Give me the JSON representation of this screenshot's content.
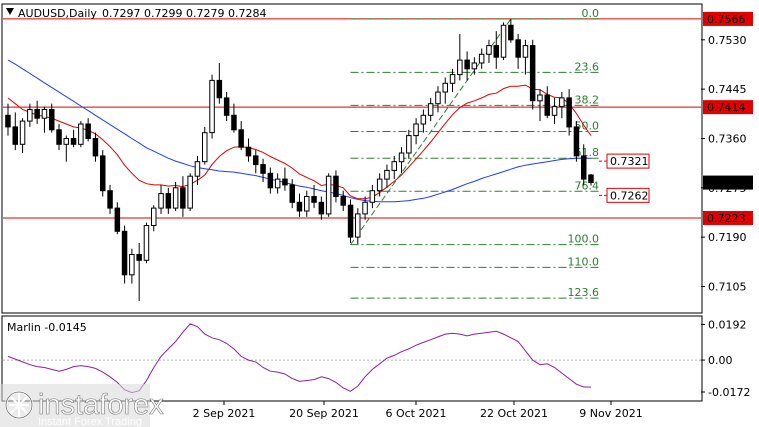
{
  "header": {
    "symbol_label": "AUDUSD,Daily",
    "ohlc_label": "0.7297 0.7299 0.7279 0.7284"
  },
  "oscillator": {
    "label": "Marlin -0.0145"
  },
  "watermark": {
    "brand": "instaforex",
    "tagline": "Instant Forex Trading"
  },
  "colors": {
    "red": "#e00000",
    "blue": "#1f3cff",
    "green": "#2e7d32",
    "purple": "#8b1fa6",
    "grid": "#b5b5b5",
    "bull": "#ffffff",
    "bear": "#000000"
  },
  "chart_data": [
    {
      "type": "candlestick",
      "title": "AUDUSD,Daily",
      "ylim": [
        0.7061,
        0.759
      ],
      "y_ticks": [
        "0.7530",
        "0.7445",
        "0.7360",
        "0.7275",
        "0.7190",
        "0.7105"
      ],
      "x_ticks": [
        "2 Sep 2021",
        "20 Sep 2021",
        "6 Oct 2021",
        "22 Oct 2021",
        "9 Nov 2021"
      ],
      "horizontal_levels": [
        {
          "value": 0.7566,
          "label": "0.7566",
          "color": "red"
        },
        {
          "value": 0.7414,
          "label": "0.7414",
          "color": "red"
        },
        {
          "value": 0.7223,
          "label": "0.7223",
          "color": "red"
        }
      ],
      "price_tags": [
        {
          "value": 0.7321,
          "label": "0.7321",
          "style": "outlined-red"
        },
        {
          "value": 0.7262,
          "label": "0.7262",
          "style": "outlined-red"
        },
        {
          "value": 0.7284,
          "label": "0.7284",
          "style": "current-black"
        }
      ],
      "fibonacci": {
        "high": 0.7566,
        "low": 0.7177,
        "levels": [
          {
            "label": "0.0",
            "value": 0.7566
          },
          {
            "label": "23.6",
            "value": 0.7474
          },
          {
            "label": "38.2",
            "value": 0.7417
          },
          {
            "label": "50.0",
            "value": 0.7372
          },
          {
            "label": "61.8",
            "value": 0.7326
          },
          {
            "label": "76.4",
            "value": 0.7269
          },
          {
            "label": "100.0",
            "value": 0.7177
          },
          {
            "label": "110.0",
            "value": 0.7138
          },
          {
            "label": "123.6",
            "value": 0.7085
          }
        ]
      },
      "candles": [
        [
          0.74,
          0.742,
          0.7365,
          0.738
        ],
        [
          0.738,
          0.7405,
          0.734,
          0.735
        ],
        [
          0.735,
          0.7395,
          0.7335,
          0.739
        ],
        [
          0.739,
          0.742,
          0.738,
          0.741
        ],
        [
          0.741,
          0.7425,
          0.7385,
          0.7395
        ],
        [
          0.7395,
          0.7415,
          0.737,
          0.741
        ],
        [
          0.741,
          0.742,
          0.737,
          0.7375
        ],
        [
          0.7375,
          0.7385,
          0.734,
          0.735
        ],
        [
          0.735,
          0.7365,
          0.732,
          0.736
        ],
        [
          0.736,
          0.7375,
          0.7345,
          0.735
        ],
        [
          0.735,
          0.739,
          0.7345,
          0.7385
        ],
        [
          0.7385,
          0.7395,
          0.7355,
          0.736
        ],
        [
          0.736,
          0.737,
          0.732,
          0.733
        ],
        [
          0.733,
          0.734,
          0.726,
          0.727
        ],
        [
          0.727,
          0.728,
          0.723,
          0.724
        ],
        [
          0.724,
          0.725,
          0.7195,
          0.72
        ],
        [
          0.72,
          0.721,
          0.711,
          0.7125
        ],
        [
          0.7125,
          0.717,
          0.711,
          0.716
        ],
        [
          0.716,
          0.718,
          0.708,
          0.715
        ],
        [
          0.715,
          0.7215,
          0.7145,
          0.721
        ],
        [
          0.721,
          0.7245,
          0.72,
          0.724
        ],
        [
          0.724,
          0.728,
          0.723,
          0.7265
        ],
        [
          0.7265,
          0.7275,
          0.723,
          0.724
        ],
        [
          0.724,
          0.7285,
          0.7235,
          0.7275
        ],
        [
          0.7275,
          0.7295,
          0.7225,
          0.724
        ],
        [
          0.724,
          0.73,
          0.7235,
          0.7295
        ],
        [
          0.7295,
          0.733,
          0.728,
          0.732
        ],
        [
          0.732,
          0.738,
          0.7315,
          0.737
        ],
        [
          0.737,
          0.747,
          0.736,
          0.746
        ],
        [
          0.746,
          0.749,
          0.742,
          0.743
        ],
        [
          0.743,
          0.744,
          0.739,
          0.74
        ],
        [
          0.74,
          0.742,
          0.737,
          0.7375
        ],
        [
          0.7375,
          0.739,
          0.734,
          0.7345
        ],
        [
          0.7345,
          0.736,
          0.732,
          0.733
        ],
        [
          0.733,
          0.734,
          0.73,
          0.7315
        ],
        [
          0.7315,
          0.7325,
          0.7285,
          0.73
        ],
        [
          0.73,
          0.731,
          0.7265,
          0.7275
        ],
        [
          0.7275,
          0.73,
          0.7265,
          0.729
        ],
        [
          0.729,
          0.731,
          0.727,
          0.728
        ],
        [
          0.728,
          0.729,
          0.724,
          0.725
        ],
        [
          0.725,
          0.7265,
          0.7225,
          0.7235
        ],
        [
          0.7235,
          0.727,
          0.7225,
          0.726
        ],
        [
          0.726,
          0.728,
          0.724,
          0.725
        ],
        [
          0.725,
          0.726,
          0.722,
          0.723
        ],
        [
          0.723,
          0.73,
          0.7225,
          0.7295
        ],
        [
          0.7295,
          0.7305,
          0.725,
          0.726
        ],
        [
          0.726,
          0.727,
          0.7235,
          0.7245
        ],
        [
          0.7245,
          0.7255,
          0.718,
          0.719
        ],
        [
          0.719,
          0.724,
          0.7178,
          0.723
        ],
        [
          0.723,
          0.726,
          0.722,
          0.725
        ],
        [
          0.725,
          0.728,
          0.724,
          0.727
        ],
        [
          0.727,
          0.73,
          0.726,
          0.729
        ],
        [
          0.729,
          0.7315,
          0.7275,
          0.7305
        ],
        [
          0.7305,
          0.733,
          0.729,
          0.732
        ],
        [
          0.732,
          0.7345,
          0.73,
          0.7335
        ],
        [
          0.7335,
          0.7375,
          0.7325,
          0.7365
        ],
        [
          0.7365,
          0.7395,
          0.735,
          0.7385
        ],
        [
          0.7385,
          0.741,
          0.737,
          0.74
        ],
        [
          0.74,
          0.743,
          0.739,
          0.742
        ],
        [
          0.742,
          0.745,
          0.7405,
          0.744
        ],
        [
          0.744,
          0.7465,
          0.742,
          0.7455
        ],
        [
          0.7455,
          0.748,
          0.744,
          0.747
        ],
        [
          0.747,
          0.754,
          0.746,
          0.7495
        ],
        [
          0.7495,
          0.751,
          0.746,
          0.748
        ],
        [
          0.748,
          0.75,
          0.747,
          0.749
        ],
        [
          0.749,
          0.7515,
          0.748,
          0.7505
        ],
        [
          0.7505,
          0.753,
          0.749,
          0.752
        ],
        [
          0.752,
          0.7545,
          0.748,
          0.75
        ],
        [
          0.75,
          0.756,
          0.7495,
          0.7555
        ],
        [
          0.7555,
          0.7566,
          0.7525,
          0.753
        ],
        [
          0.753,
          0.754,
          0.748,
          0.75
        ],
        [
          0.75,
          0.753,
          0.747,
          0.752
        ],
        [
          0.752,
          0.753,
          0.741,
          0.7425
        ],
        [
          0.7425,
          0.7445,
          0.739,
          0.7435
        ],
        [
          0.7435,
          0.745,
          0.7395,
          0.74
        ],
        [
          0.74,
          0.743,
          0.7385,
          0.7415
        ],
        [
          0.7415,
          0.744,
          0.7395,
          0.743
        ],
        [
          0.743,
          0.7445,
          0.7365,
          0.738
        ],
        [
          0.738,
          0.739,
          0.732,
          0.733
        ],
        [
          0.733,
          0.735,
          0.728,
          0.729
        ],
        [
          0.7297,
          0.7299,
          0.7279,
          0.7284
        ]
      ],
      "series": [
        {
          "name": "",
          "color": "red",
          "values": [
            0.743,
            0.742,
            0.741,
            0.7405,
            0.74,
            0.7398,
            0.7395,
            0.739,
            0.7385,
            0.738,
            0.7378,
            0.7374,
            0.7368,
            0.7358,
            0.7346,
            0.7332,
            0.7314,
            0.73,
            0.7288,
            0.7282,
            0.728,
            0.728,
            0.7278,
            0.7279,
            0.7277,
            0.7281,
            0.7288,
            0.7297,
            0.7315,
            0.7329,
            0.7339,
            0.7345,
            0.7346,
            0.7344,
            0.7341,
            0.7336,
            0.7329,
            0.7323,
            0.7317,
            0.7309,
            0.7299,
            0.7293,
            0.7287,
            0.7279,
            0.7281,
            0.7279,
            0.7275,
            0.7261,
            0.7256,
            0.7256,
            0.7259,
            0.7267,
            0.7276,
            0.7286,
            0.7297,
            0.7311,
            0.7325,
            0.7339,
            0.7354,
            0.737,
            0.7386,
            0.7401,
            0.7413,
            0.7421,
            0.7425,
            0.743,
            0.7436,
            0.7438,
            0.7446,
            0.745,
            0.745,
            0.7452,
            0.7445,
            0.7444,
            0.7436,
            0.7431,
            0.743,
            0.742,
            0.7403,
            0.7383,
            0.7365
          ]
        },
        {
          "name": "",
          "color": "blue",
          "values": [
            0.7495,
            0.7488,
            0.748,
            0.7472,
            0.7464,
            0.7456,
            0.7448,
            0.744,
            0.7432,
            0.7424,
            0.7416,
            0.7408,
            0.74,
            0.7392,
            0.7384,
            0.7376,
            0.7368,
            0.736,
            0.7352,
            0.7344,
            0.7338,
            0.7332,
            0.7326,
            0.7321,
            0.7317,
            0.7313,
            0.731,
            0.7308,
            0.7306,
            0.7304,
            0.7303,
            0.7302,
            0.73,
            0.7298,
            0.7296,
            0.7293,
            0.729,
            0.7287,
            0.7284,
            0.7281,
            0.7278,
            0.7276,
            0.7273,
            0.727,
            0.7268,
            0.7265,
            0.7262,
            0.7258,
            0.7255,
            0.7253,
            0.7252,
            0.7251,
            0.7251,
            0.7251,
            0.7252,
            0.7253,
            0.7255,
            0.7257,
            0.726,
            0.7264,
            0.7268,
            0.7272,
            0.7277,
            0.7282,
            0.7286,
            0.7291,
            0.7295,
            0.7299,
            0.7303,
            0.7307,
            0.7311,
            0.7314,
            0.7316,
            0.7318,
            0.732,
            0.7322,
            0.7324,
            0.7325,
            0.7326,
            0.7326,
            0.7326
          ]
        }
      ]
    },
    {
      "type": "line",
      "title": "Marlin -0.0145",
      "ylim": [
        -0.0215,
        0.0232
      ],
      "y_ticks": [
        "0.0192",
        "0.00",
        "-0.0172"
      ],
      "series": [
        {
          "name": "Marlin",
          "color": "purple",
          "values": [
            0.002,
            0.0005,
            -0.001,
            -0.0025,
            -0.0035,
            -0.004,
            -0.005,
            -0.006,
            -0.005,
            -0.0035,
            -0.003,
            -0.0035,
            -0.0045,
            -0.0065,
            -0.009,
            -0.012,
            -0.016,
            -0.0175,
            -0.0165,
            -0.011,
            -0.004,
            0.002,
            0.006,
            0.01,
            0.015,
            0.0195,
            0.018,
            0.014,
            0.012,
            0.011,
            0.009,
            0.006,
            0.002,
            0.0,
            -0.001,
            -0.004,
            -0.006,
            -0.0065,
            -0.0075,
            -0.01,
            -0.0115,
            -0.011,
            -0.0105,
            -0.009,
            -0.01,
            -0.012,
            -0.015,
            -0.0168,
            -0.014,
            -0.009,
            -0.005,
            -0.002,
            0.001,
            0.0025,
            0.0045,
            0.006,
            0.008,
            0.0095,
            0.011,
            0.0125,
            0.014,
            0.0145,
            0.014,
            0.013,
            0.014,
            0.0145,
            0.015,
            0.0155,
            0.014,
            0.012,
            0.01,
            0.005,
            0.0,
            -0.0025,
            -0.002,
            -0.004,
            -0.007,
            -0.01,
            -0.013,
            -0.0145,
            -0.0145
          ]
        }
      ]
    }
  ]
}
